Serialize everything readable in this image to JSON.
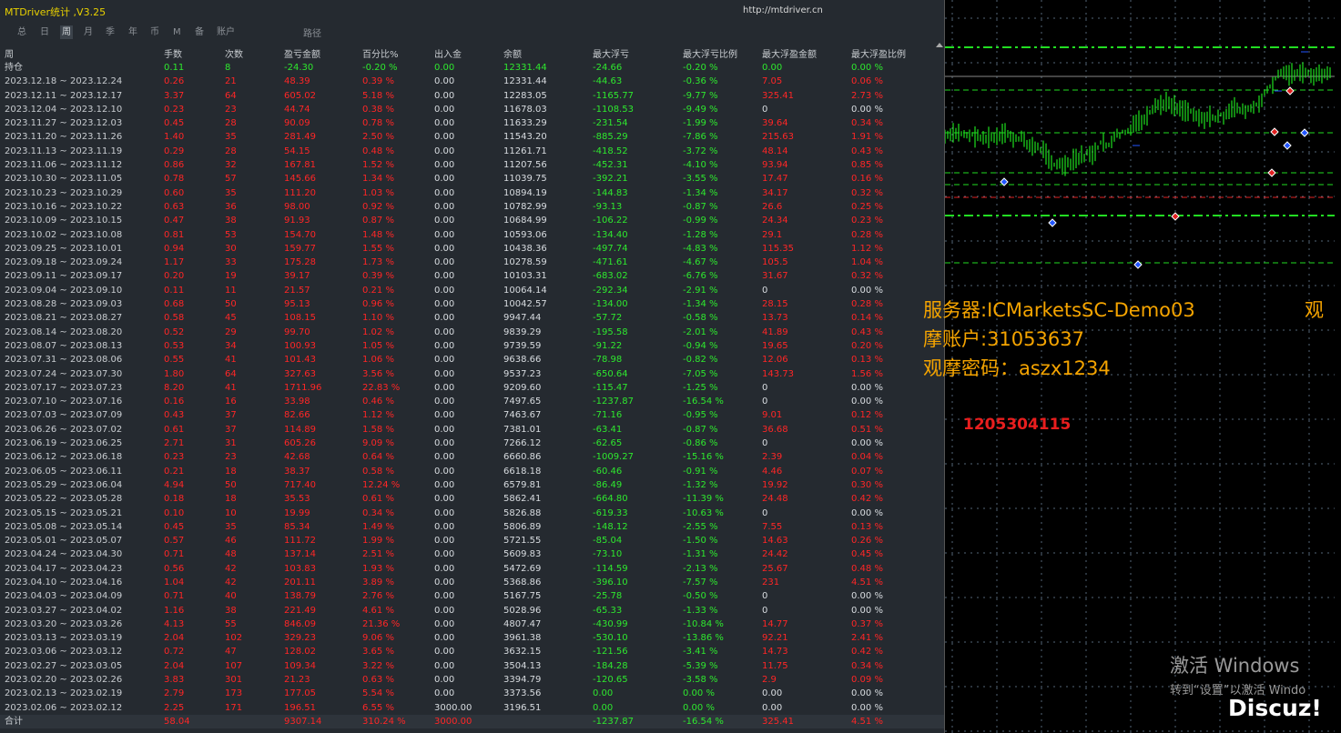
{
  "window": {
    "title": "MTDriver统计 ,V3.25",
    "url": "http://mtdriver.cn"
  },
  "tabs": [
    {
      "label": "总",
      "active": false
    },
    {
      "label": "日",
      "active": false
    },
    {
      "label": "周",
      "active": true
    },
    {
      "label": "月",
      "active": false
    },
    {
      "label": "季",
      "active": false
    },
    {
      "label": "年",
      "active": false
    },
    {
      "label": "币",
      "active": false
    },
    {
      "label": "M",
      "active": false
    },
    {
      "label": "备",
      "active": false
    },
    {
      "label": "账户",
      "active": false
    }
  ],
  "path_label": "路径",
  "columns": [
    "周",
    "手数",
    "次数",
    "盈亏金额",
    "百分比%",
    "出入金",
    "余额",
    "最大浮亏",
    "最大浮亏比例",
    "最大浮盈金额",
    "最大浮盈比例"
  ],
  "position_row": [
    "持仓",
    "0.11",
    "8",
    "-24.30",
    "-0.20 %",
    "0.00",
    "12331.44",
    "-24.66",
    "-0.20 %",
    "0.00",
    "0.00 %"
  ],
  "rows": [
    [
      "2023.12.18 ~ 2023.12.24",
      "0.26",
      "21",
      "48.39",
      "0.39 %",
      "0.00",
      "12331.44",
      "-44.63",
      "-0.36 %",
      "7.05",
      "0.06 %"
    ],
    [
      "2023.12.11 ~ 2023.12.17",
      "3.37",
      "64",
      "605.02",
      "5.18 %",
      "0.00",
      "12283.05",
      "-1165.77",
      "-9.77 %",
      "325.41",
      "2.73 %"
    ],
    [
      "2023.12.04 ~ 2023.12.10",
      "0.23",
      "23",
      "44.74",
      "0.38 %",
      "0.00",
      "11678.03",
      "-1108.53",
      "-9.49 %",
      "0",
      "0.00 %"
    ],
    [
      "2023.11.27 ~ 2023.12.03",
      "0.45",
      "28",
      "90.09",
      "0.78 %",
      "0.00",
      "11633.29",
      "-231.54",
      "-1.99 %",
      "39.64",
      "0.34 %"
    ],
    [
      "2023.11.20 ~ 2023.11.26",
      "1.40",
      "35",
      "281.49",
      "2.50 %",
      "0.00",
      "11543.20",
      "-885.29",
      "-7.86 %",
      "215.63",
      "1.91 %"
    ],
    [
      "2023.11.13 ~ 2023.11.19",
      "0.29",
      "28",
      "54.15",
      "0.48 %",
      "0.00",
      "11261.71",
      "-418.52",
      "-3.72 %",
      "48.14",
      "0.43 %"
    ],
    [
      "2023.11.06 ~ 2023.11.12",
      "0.86",
      "32",
      "167.81",
      "1.52 %",
      "0.00",
      "11207.56",
      "-452.31",
      "-4.10 %",
      "93.94",
      "0.85 %"
    ],
    [
      "2023.10.30 ~ 2023.11.05",
      "0.78",
      "57",
      "145.66",
      "1.34 %",
      "0.00",
      "11039.75",
      "-392.21",
      "-3.55 %",
      "17.47",
      "0.16 %"
    ],
    [
      "2023.10.23 ~ 2023.10.29",
      "0.60",
      "35",
      "111.20",
      "1.03 %",
      "0.00",
      "10894.19",
      "-144.83",
      "-1.34 %",
      "34.17",
      "0.32 %"
    ],
    [
      "2023.10.16 ~ 2023.10.22",
      "0.63",
      "36",
      "98.00",
      "0.92 %",
      "0.00",
      "10782.99",
      "-93.13",
      "-0.87 %",
      "26.6",
      "0.25 %"
    ],
    [
      "2023.10.09 ~ 2023.10.15",
      "0.47",
      "38",
      "91.93",
      "0.87 %",
      "0.00",
      "10684.99",
      "-106.22",
      "-0.99 %",
      "24.34",
      "0.23 %"
    ],
    [
      "2023.10.02 ~ 2023.10.08",
      "0.81",
      "53",
      "154.70",
      "1.48 %",
      "0.00",
      "10593.06",
      "-134.40",
      "-1.28 %",
      "29.1",
      "0.28 %"
    ],
    [
      "2023.09.25 ~ 2023.10.01",
      "0.94",
      "30",
      "159.77",
      "1.55 %",
      "0.00",
      "10438.36",
      "-497.74",
      "-4.83 %",
      "115.35",
      "1.12 %"
    ],
    [
      "2023.09.18 ~ 2023.09.24",
      "1.17",
      "33",
      "175.28",
      "1.73 %",
      "0.00",
      "10278.59",
      "-471.61",
      "-4.67 %",
      "105.5",
      "1.04 %"
    ],
    [
      "2023.09.11 ~ 2023.09.17",
      "0.20",
      "19",
      "39.17",
      "0.39 %",
      "0.00",
      "10103.31",
      "-683.02",
      "-6.76 %",
      "31.67",
      "0.32 %"
    ],
    [
      "2023.09.04 ~ 2023.09.10",
      "0.11",
      "11",
      "21.57",
      "0.21 %",
      "0.00",
      "10064.14",
      "-292.34",
      "-2.91 %",
      "0",
      "0.00 %"
    ],
    [
      "2023.08.28 ~ 2023.09.03",
      "0.68",
      "50",
      "95.13",
      "0.96 %",
      "0.00",
      "10042.57",
      "-134.00",
      "-1.34 %",
      "28.15",
      "0.28 %"
    ],
    [
      "2023.08.21 ~ 2023.08.27",
      "0.58",
      "45",
      "108.15",
      "1.10 %",
      "0.00",
      "9947.44",
      "-57.72",
      "-0.58 %",
      "13.73",
      "0.14 %"
    ],
    [
      "2023.08.14 ~ 2023.08.20",
      "0.52",
      "29",
      "99.70",
      "1.02 %",
      "0.00",
      "9839.29",
      "-195.58",
      "-2.01 %",
      "41.89",
      "0.43 %"
    ],
    [
      "2023.08.07 ~ 2023.08.13",
      "0.53",
      "34",
      "100.93",
      "1.05 %",
      "0.00",
      "9739.59",
      "-91.22",
      "-0.94 %",
      "19.65",
      "0.20 %"
    ],
    [
      "2023.07.31 ~ 2023.08.06",
      "0.55",
      "41",
      "101.43",
      "1.06 %",
      "0.00",
      "9638.66",
      "-78.98",
      "-0.82 %",
      "12.06",
      "0.13 %"
    ],
    [
      "2023.07.24 ~ 2023.07.30",
      "1.80",
      "64",
      "327.63",
      "3.56 %",
      "0.00",
      "9537.23",
      "-650.64",
      "-7.05 %",
      "143.73",
      "1.56 %"
    ],
    [
      "2023.07.17 ~ 2023.07.23",
      "8.20",
      "41",
      "1711.96",
      "22.83 %",
      "0.00",
      "9209.60",
      "-115.47",
      "-1.25 %",
      "0",
      "0.00 %"
    ],
    [
      "2023.07.10 ~ 2023.07.16",
      "0.16",
      "16",
      "33.98",
      "0.46 %",
      "0.00",
      "7497.65",
      "-1237.87",
      "-16.54 %",
      "0",
      "0.00 %"
    ],
    [
      "2023.07.03 ~ 2023.07.09",
      "0.43",
      "37",
      "82.66",
      "1.12 %",
      "0.00",
      "7463.67",
      "-71.16",
      "-0.95 %",
      "9.01",
      "0.12 %"
    ],
    [
      "2023.06.26 ~ 2023.07.02",
      "0.61",
      "37",
      "114.89",
      "1.58 %",
      "0.00",
      "7381.01",
      "-63.41",
      "-0.87 %",
      "36.68",
      "0.51 %"
    ],
    [
      "2023.06.19 ~ 2023.06.25",
      "2.71",
      "31",
      "605.26",
      "9.09 %",
      "0.00",
      "7266.12",
      "-62.65",
      "-0.86 %",
      "0",
      "0.00 %"
    ],
    [
      "2023.06.12 ~ 2023.06.18",
      "0.23",
      "23",
      "42.68",
      "0.64 %",
      "0.00",
      "6660.86",
      "-1009.27",
      "-15.16 %",
      "2.39",
      "0.04 %"
    ],
    [
      "2023.06.05 ~ 2023.06.11",
      "0.21",
      "18",
      "38.37",
      "0.58 %",
      "0.00",
      "6618.18",
      "-60.46",
      "-0.91 %",
      "4.46",
      "0.07 %"
    ],
    [
      "2023.05.29 ~ 2023.06.04",
      "4.94",
      "50",
      "717.40",
      "12.24 %",
      "0.00",
      "6579.81",
      "-86.49",
      "-1.32 %",
      "19.92",
      "0.30 %"
    ],
    [
      "2023.05.22 ~ 2023.05.28",
      "0.18",
      "18",
      "35.53",
      "0.61 %",
      "0.00",
      "5862.41",
      "-664.80",
      "-11.39 %",
      "24.48",
      "0.42 %"
    ],
    [
      "2023.05.15 ~ 2023.05.21",
      "0.10",
      "10",
      "19.99",
      "0.34 %",
      "0.00",
      "5826.88",
      "-619.33",
      "-10.63 %",
      "0",
      "0.00 %"
    ],
    [
      "2023.05.08 ~ 2023.05.14",
      "0.45",
      "35",
      "85.34",
      "1.49 %",
      "0.00",
      "5806.89",
      "-148.12",
      "-2.55 %",
      "7.55",
      "0.13 %"
    ],
    [
      "2023.05.01 ~ 2023.05.07",
      "0.57",
      "46",
      "111.72",
      "1.99 %",
      "0.00",
      "5721.55",
      "-85.04",
      "-1.50 %",
      "14.63",
      "0.26 %"
    ],
    [
      "2023.04.24 ~ 2023.04.30",
      "0.71",
      "48",
      "137.14",
      "2.51 %",
      "0.00",
      "5609.83",
      "-73.10",
      "-1.31 %",
      "24.42",
      "0.45 %"
    ],
    [
      "2023.04.17 ~ 2023.04.23",
      "0.56",
      "42",
      "103.83",
      "1.93 %",
      "0.00",
      "5472.69",
      "-114.59",
      "-2.13 %",
      "25.67",
      "0.48 %"
    ],
    [
      "2023.04.10 ~ 2023.04.16",
      "1.04",
      "42",
      "201.11",
      "3.89 %",
      "0.00",
      "5368.86",
      "-396.10",
      "-7.57 %",
      "231",
      "4.51 %"
    ],
    [
      "2023.04.03 ~ 2023.04.09",
      "0.71",
      "40",
      "138.79",
      "2.76 %",
      "0.00",
      "5167.75",
      "-25.78",
      "-0.50 %",
      "0",
      "0.00 %"
    ],
    [
      "2023.03.27 ~ 2023.04.02",
      "1.16",
      "38",
      "221.49",
      "4.61 %",
      "0.00",
      "5028.96",
      "-65.33",
      "-1.33 %",
      "0",
      "0.00 %"
    ],
    [
      "2023.03.20 ~ 2023.03.26",
      "4.13",
      "55",
      "846.09",
      "21.36 %",
      "0.00",
      "4807.47",
      "-430.99",
      "-10.84 %",
      "14.77",
      "0.37 %"
    ],
    [
      "2023.03.13 ~ 2023.03.19",
      "2.04",
      "102",
      "329.23",
      "9.06 %",
      "0.00",
      "3961.38",
      "-530.10",
      "-13.86 %",
      "92.21",
      "2.41 %"
    ],
    [
      "2023.03.06 ~ 2023.03.12",
      "0.72",
      "47",
      "128.02",
      "3.65 %",
      "0.00",
      "3632.15",
      "-121.56",
      "-3.41 %",
      "14.73",
      "0.42 %"
    ],
    [
      "2023.02.27 ~ 2023.03.05",
      "2.04",
      "107",
      "109.34",
      "3.22 %",
      "0.00",
      "3504.13",
      "-184.28",
      "-5.39 %",
      "11.75",
      "0.34 %"
    ],
    [
      "2023.02.20 ~ 2023.02.26",
      "3.83",
      "301",
      "21.23",
      "0.63 %",
      "0.00",
      "3394.79",
      "-120.65",
      "-3.58 %",
      "2.9",
      "0.09 %"
    ],
    [
      "2023.02.13 ~ 2023.02.19",
      "2.79",
      "173",
      "177.05",
      "5.54 %",
      "0.00",
      "3373.56",
      "0.00",
      "0.00 %",
      "0.00",
      "0.00 %"
    ],
    [
      "2023.02.06 ~ 2023.02.12",
      "2.25",
      "171",
      "196.51",
      "6.55 %",
      "3000.00",
      "3196.51",
      "0.00",
      "0.00 %",
      "0.00",
      "0.00 %"
    ]
  ],
  "total_row": [
    "合计",
    "58.04",
    "",
    "9307.14",
    "310.24 %",
    "3000.00",
    "",
    "-1237.87",
    "-16.54 %",
    "325.41",
    "4.51 %"
  ],
  "overlay": {
    "server": "服务器:ICMarketsSC-Demo03",
    "view_char": "观",
    "account": "摩账户:31053637",
    "password": "观摩密码：aszx1234",
    "qq": "1205304115"
  },
  "watermark": {
    "line1": "激活 Windows",
    "line2": "转到“设置”以激活 Windo",
    "brand": "Discuz!"
  },
  "colors": {
    "profit": "#ff2626",
    "loss": "#2ee82e",
    "overlay": "#f5a400",
    "title": "#e8d000"
  }
}
